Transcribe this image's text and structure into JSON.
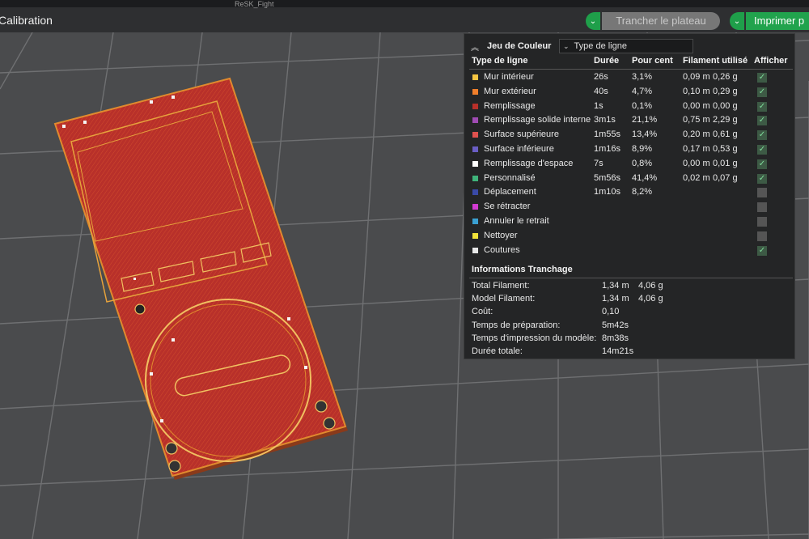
{
  "topbar": {
    "top_fragment": "ReSK_Fight",
    "tab_title": "Calibration",
    "slice_label": "Trancher le plateau",
    "print_label": "Imprimer p"
  },
  "panel": {
    "title": "Jeu de Couleur",
    "select_value": "Type de ligne",
    "headers": {
      "type": "Type de ligne",
      "duration": "Durée",
      "percent": "Pour cent",
      "filament": "Filament utilisé",
      "show": "Afficher"
    },
    "rows": [
      {
        "name": "Mur intérieur",
        "color": "#f5c542",
        "duration": "26s",
        "percent": "3,1%",
        "meters": "0,09 m",
        "grams": "0,26 g",
        "shown": true
      },
      {
        "name": "Mur extérieur",
        "color": "#f07f2b",
        "duration": "40s",
        "percent": "4,7%",
        "meters": "0,10 m",
        "grams": "0,29 g",
        "shown": true
      },
      {
        "name": "Remplissage",
        "color": "#b8302a",
        "duration": "1s",
        "percent": "0,1%",
        "meters": "0,00 m",
        "grams": "0,00 g",
        "shown": true
      },
      {
        "name": "Remplissage solide interne",
        "color": "#a04bb4",
        "duration": "3m1s",
        "percent": "21,1%",
        "meters": "0,75 m",
        "grams": "2,29 g",
        "shown": true
      },
      {
        "name": "Surface supérieure",
        "color": "#e0524f",
        "duration": "1m55s",
        "percent": "13,4%",
        "meters": "0,20 m",
        "grams": "0,61 g",
        "shown": true
      },
      {
        "name": "Surface inférieure",
        "color": "#6a5ec4",
        "duration": "1m16s",
        "percent": "8,9%",
        "meters": "0,17 m",
        "grams": "0,53 g",
        "shown": true
      },
      {
        "name": "Remplissage d'espace",
        "color": "#ffffff",
        "duration": "7s",
        "percent": "0,8%",
        "meters": "0,00 m",
        "grams": "0,01 g",
        "shown": true
      },
      {
        "name": "Personnalisé",
        "color": "#3fb37a",
        "duration": "5m56s",
        "percent": "41,4%",
        "meters": "0,02 m",
        "grams": "0,07 g",
        "shown": true
      },
      {
        "name": "Déplacement",
        "color": "#3a4aa8",
        "duration": "1m10s",
        "percent": "8,2%",
        "meters": "",
        "grams": "",
        "shown": false
      },
      {
        "name": "Se rétracter",
        "color": "#d23ad2",
        "duration": "",
        "percent": "",
        "meters": "",
        "grams": "",
        "shown": false
      },
      {
        "name": "Annuler le retrait",
        "color": "#3aa0d2",
        "duration": "",
        "percent": "",
        "meters": "",
        "grams": "",
        "shown": false
      },
      {
        "name": "Nettoyer",
        "color": "#f2e33a",
        "duration": "",
        "percent": "",
        "meters": "",
        "grams": "",
        "shown": false
      },
      {
        "name": "Coutures",
        "color": "#e8e8e8",
        "duration": "",
        "percent": "",
        "meters": "",
        "grams": "",
        "shown": true
      }
    ],
    "info_title": "Informations Tranchage",
    "info": [
      {
        "label": "Total Filament:",
        "v1": "1,34 m",
        "v2": "4,06 g"
      },
      {
        "label": "Model Filament:",
        "v1": "1,34 m",
        "v2": "4,06 g"
      },
      {
        "label": "Coût:",
        "v1": "0,10",
        "v2": ""
      },
      {
        "label": "Temps de préparation:",
        "v1": "5m42s",
        "v2": ""
      },
      {
        "label": "Temps d'impression du modèle:",
        "v1": "8m38s",
        "v2": ""
      },
      {
        "label": "Durée totale:",
        "v1": "14m21s",
        "v2": ""
      }
    ]
  },
  "colors": {
    "accent": "#21a34d",
    "model_fill": "#b8302a",
    "model_edge": "#e08a2e"
  }
}
